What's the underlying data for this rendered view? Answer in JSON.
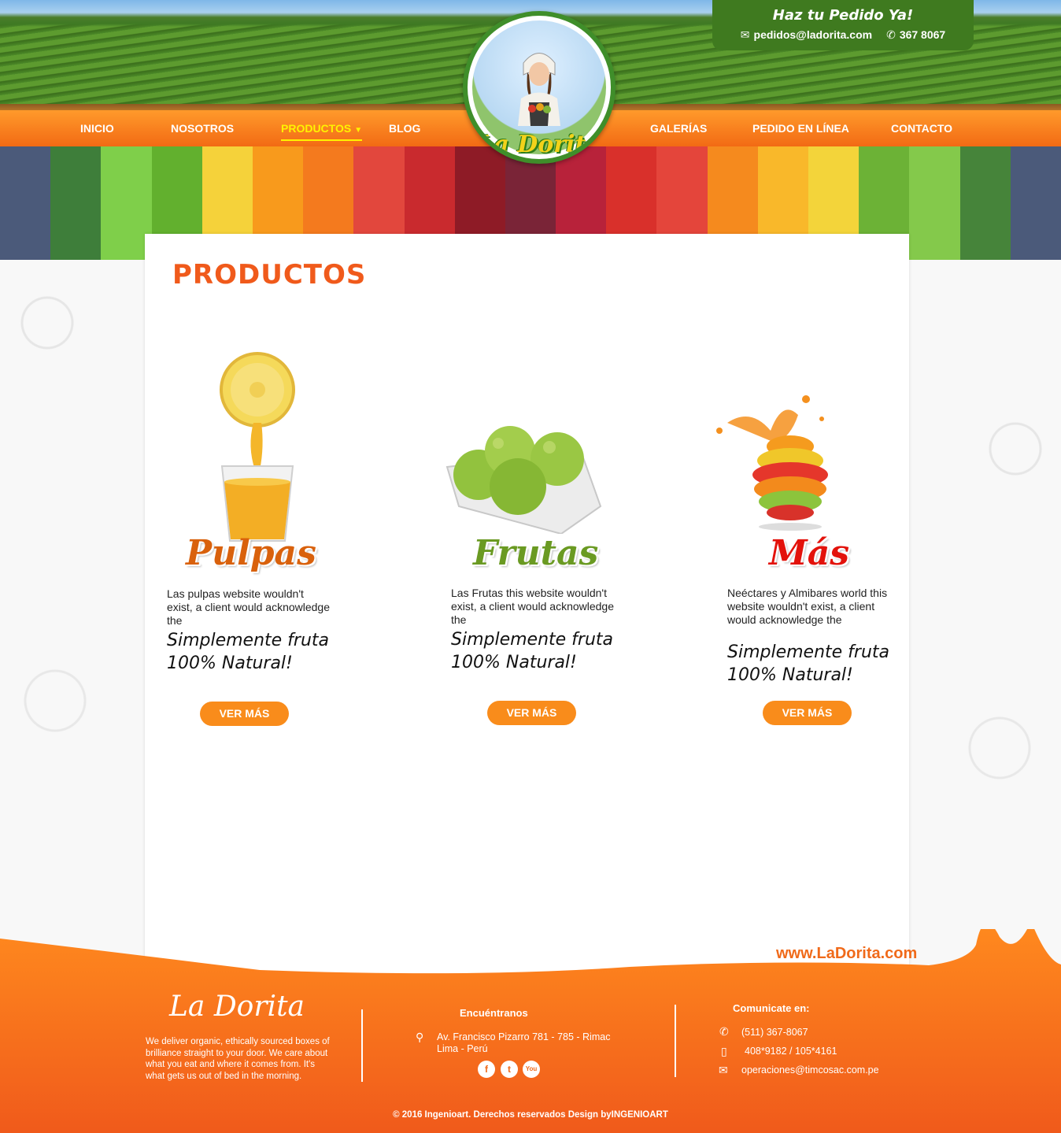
{
  "header": {
    "order_title": "Haz tu Pedido Ya!",
    "order_email": "pedidos@ladorita.com",
    "order_phone": "367 8067",
    "logo_text": "La Dorita"
  },
  "nav": {
    "items": [
      "INICIO",
      "NOSOTROS",
      "PRODUCTOS",
      "BLOG",
      "GALERÍAS",
      "PEDIDO EN LÍNEA",
      "CONTACTO"
    ],
    "active": "PRODUCTOS"
  },
  "main": {
    "title": "PRODUCTOS",
    "products": [
      {
        "name": "Pulpas",
        "color": "#d9610c",
        "desc": "Las pulpas website wouldn't exist, a client would acknowledge the",
        "slogan_1": "Simplemente fruta",
        "slogan_2": "100% Natural!",
        "button": "VER MÁS"
      },
      {
        "name": "Frutas",
        "color": "#6a9a22",
        "desc": "Las Frutas this website wouldn't exist, a client would acknowledge the",
        "slogan_1": "Simplemente fruta",
        "slogan_2": "100% Natural!",
        "button": "VER MÁS"
      },
      {
        "name": "Más",
        "color": "#e3120b",
        "desc": "Neéctares y Almibares world this website wouldn't exist, a client would acknowledge the",
        "slogan_1": "Simplemente fruta",
        "slogan_2": "100% Natural!",
        "button": "VER MÁS"
      }
    ]
  },
  "footer": {
    "site_url": "www.LaDorita.com",
    "brand": "La Dorita",
    "about": "We deliver organic, ethically sourced boxes of brilliance straight to your door. We care about what you eat and where it comes from. It's what gets us out of bed in the morning.",
    "find_us_title": "Encuéntranos",
    "address_1": "Av. Francisco Pizarro 781 - 785 - Rimac",
    "address_2": "Lima - Perú",
    "contact_title": "Comunicate  en:",
    "phone": "(511) 367-8067",
    "mobile": "408*9182 / 105*4161",
    "email": "operaciones@timcosac.com.pe",
    "social": [
      "f",
      "t",
      "You"
    ],
    "copyright": "© 2016 Ingenioart. Derechos reservados Design byINGENIOART"
  },
  "colors": {
    "orange": "#f26a14",
    "accent_yellow": "#fff200",
    "green": "#3f7a1f",
    "button": "#f98c1b"
  }
}
